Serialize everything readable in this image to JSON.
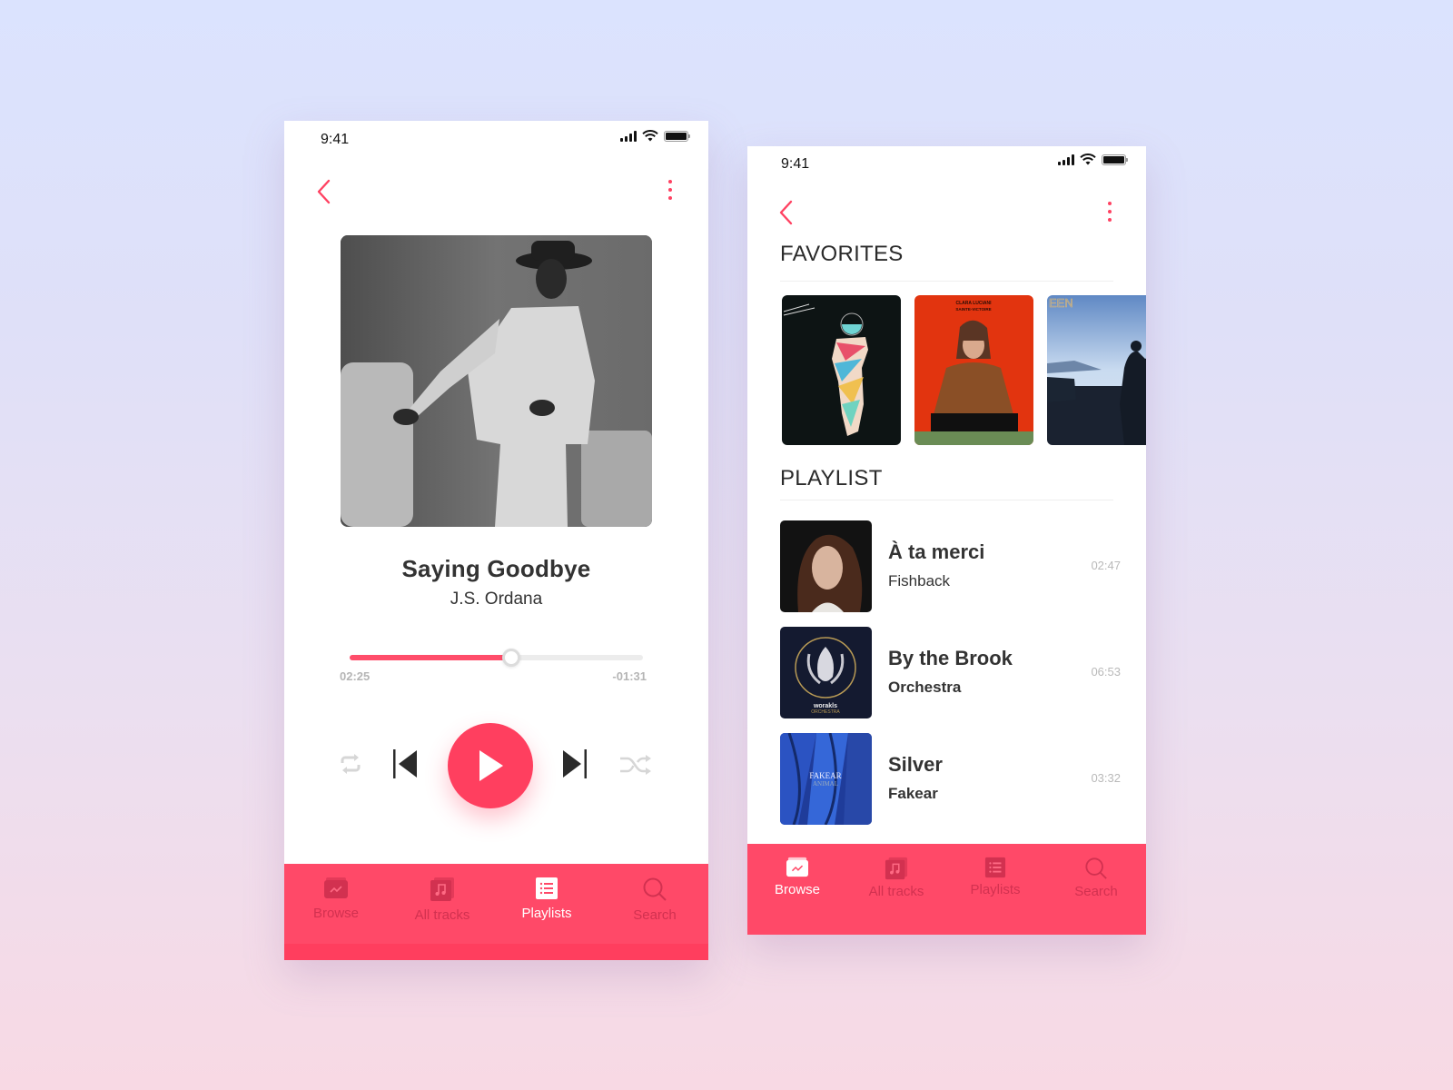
{
  "theme": {
    "accent": "#ff4262",
    "tabbar": "#ff4968",
    "inactive_tab": "#d23150"
  },
  "player": {
    "status": {
      "time": "9:41"
    },
    "track": {
      "title": "Saying Goodbye",
      "artist": "J.S. Ordana"
    },
    "progress": {
      "elapsed": "02:25",
      "remaining": "-01:31",
      "fraction": 0.55
    },
    "controls": [
      "repeat",
      "previous",
      "play",
      "next",
      "shuffle"
    ],
    "tabs": [
      {
        "label": "Browse",
        "icon": "browse-icon",
        "active": false
      },
      {
        "label": "All tracks",
        "icon": "music-note-icon",
        "active": false
      },
      {
        "label": "Playlists",
        "icon": "list-icon",
        "active": true
      },
      {
        "label": "Search",
        "icon": "search-icon",
        "active": false
      }
    ]
  },
  "library": {
    "status": {
      "time": "9:41"
    },
    "favorites": {
      "title": "FAVORITES",
      "albums": [
        {
          "name": "abstract-figure-album"
        },
        {
          "name": "Clara Luciani — Sainte-Victoire",
          "cover_text_1": "CLARA LUCIANI",
          "cover_text_2": "SAINTE-VICTOIRE"
        },
        {
          "name": "Queen album",
          "cover_text_1": "EEN"
        }
      ]
    },
    "playlist": {
      "title": "PLAYLIST",
      "items": [
        {
          "title": "À ta merci",
          "artist": "Fishback",
          "duration": "02:47"
        },
        {
          "title": "By the Brook",
          "artist": "Orchestra",
          "duration": "06:53",
          "cover_text_1": "worakls",
          "cover_text_2": "ORCHESTRA"
        },
        {
          "title": "Silver",
          "artist": "Fakear",
          "duration": "03:32",
          "cover_text_1": "FAKEAR",
          "cover_text_2": "ANIMAL"
        }
      ]
    },
    "tabs": [
      {
        "label": "Browse",
        "icon": "browse-icon",
        "active": true
      },
      {
        "label": "All tracks",
        "icon": "music-note-icon",
        "active": false
      },
      {
        "label": "Playlists",
        "icon": "list-icon",
        "active": false
      },
      {
        "label": "Search",
        "icon": "search-icon",
        "active": false
      }
    ]
  }
}
